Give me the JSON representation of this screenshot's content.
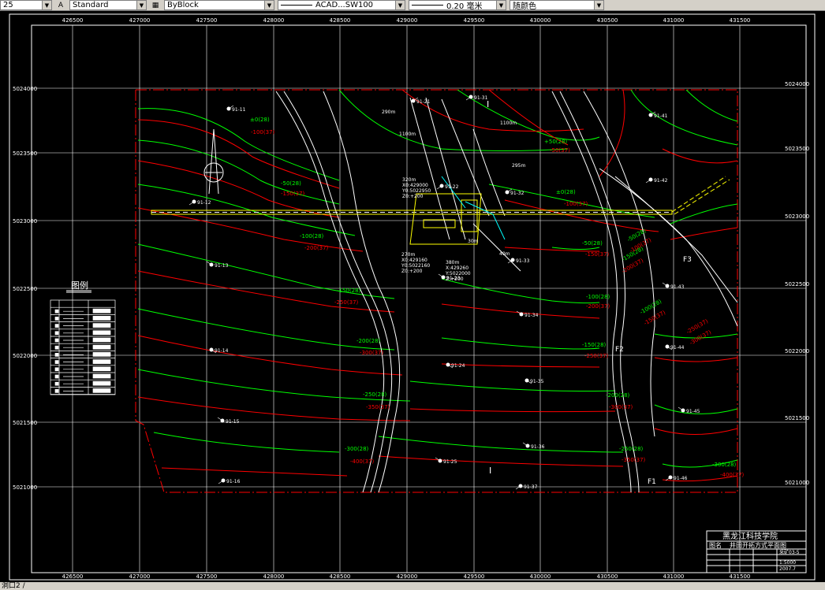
{
  "toolbar": {
    "combo0_value": "25",
    "textstyle_value": "Standard",
    "linetype_value": "ByBlock",
    "linetype2_value": "ACAD...SW100",
    "lineweight_value": "0.20 毫米",
    "color_value": "随颜色"
  },
  "drawing": {
    "x_ticks": [
      "426500",
      "427000",
      "427500",
      "428000",
      "428500",
      "429000",
      "429500",
      "430000",
      "430500",
      "431000",
      "431500"
    ],
    "y_ticks": [
      "5024000",
      "5023500",
      "5023000",
      "5022500",
      "5022000",
      "5021500",
      "5021000"
    ],
    "colors": {
      "red": "#ff0000",
      "green": "#00ff00",
      "white": "#ffffff",
      "yellow": "#ffff00",
      "cyan": "#00ffff"
    },
    "wells": [
      "91-11",
      "91-12",
      "91-13",
      "91-14",
      "91-15",
      "91-16",
      "91-21",
      "91-22",
      "91-23",
      "91-24",
      "91-25",
      "91-31",
      "91-32",
      "91-33",
      "91-34",
      "91-35",
      "91-36",
      "91-37",
      "91-41",
      "91-42",
      "91-43",
      "91-44",
      "91-45",
      "91-46"
    ],
    "contours": [
      "±0(28)",
      "-100(37)",
      "-50(28)",
      "-150(37)",
      "-100(28)",
      "-200(37)",
      "-150(28)",
      "-250(37)",
      "-200(28)",
      "-300(37)",
      "-250(28)",
      "-350(37)",
      "-300(28)",
      "-400(37)",
      "+50(28)",
      "-50(37)",
      "±0(28)",
      "-100(37)",
      "-50(28)",
      "-150(37)",
      "-100(28)",
      "-200(37)",
      "-150(28)",
      "-250(37)",
      "-200(28)",
      "-300(37)",
      "-250(28)",
      "-350(37)",
      "-300(28)",
      "-400(37)"
    ],
    "right_contours": [
      "-250(37)",
      "-300(37)",
      "-150(28)",
      "-200(37)",
      "-100(28)",
      "-150(37)",
      "-50(28)",
      "-100(37)"
    ],
    "faults": [
      "F3",
      "F2",
      "F1"
    ],
    "notes": {
      "n1": "290m",
      "n2": "1100m",
      "n3": "1100m",
      "n4": "295m",
      "n5": "320m",
      "n6": "X0:429000",
      "n7": "Y0:5022950",
      "n8": "Z0:+200",
      "n9": "270m",
      "n10": "X0:429160",
      "n11": "Y0:5022160",
      "n12": "Z0:+200",
      "n13": "380m",
      "n14": "X:429260",
      "n15": "Y:5022000",
      "n16": "Z:+200",
      "n17": "30m",
      "n18": "40m"
    },
    "legend_title": "图例",
    "title_block": {
      "school": "黑龙江科技学院",
      "label_name": "图名",
      "drawing_name": "井田开拓方式平面图",
      "scale": "1:5000",
      "date": "2007.7",
      "sheet": "采矿03-5"
    }
  },
  "status": {
    "command": "洞口2 /"
  }
}
